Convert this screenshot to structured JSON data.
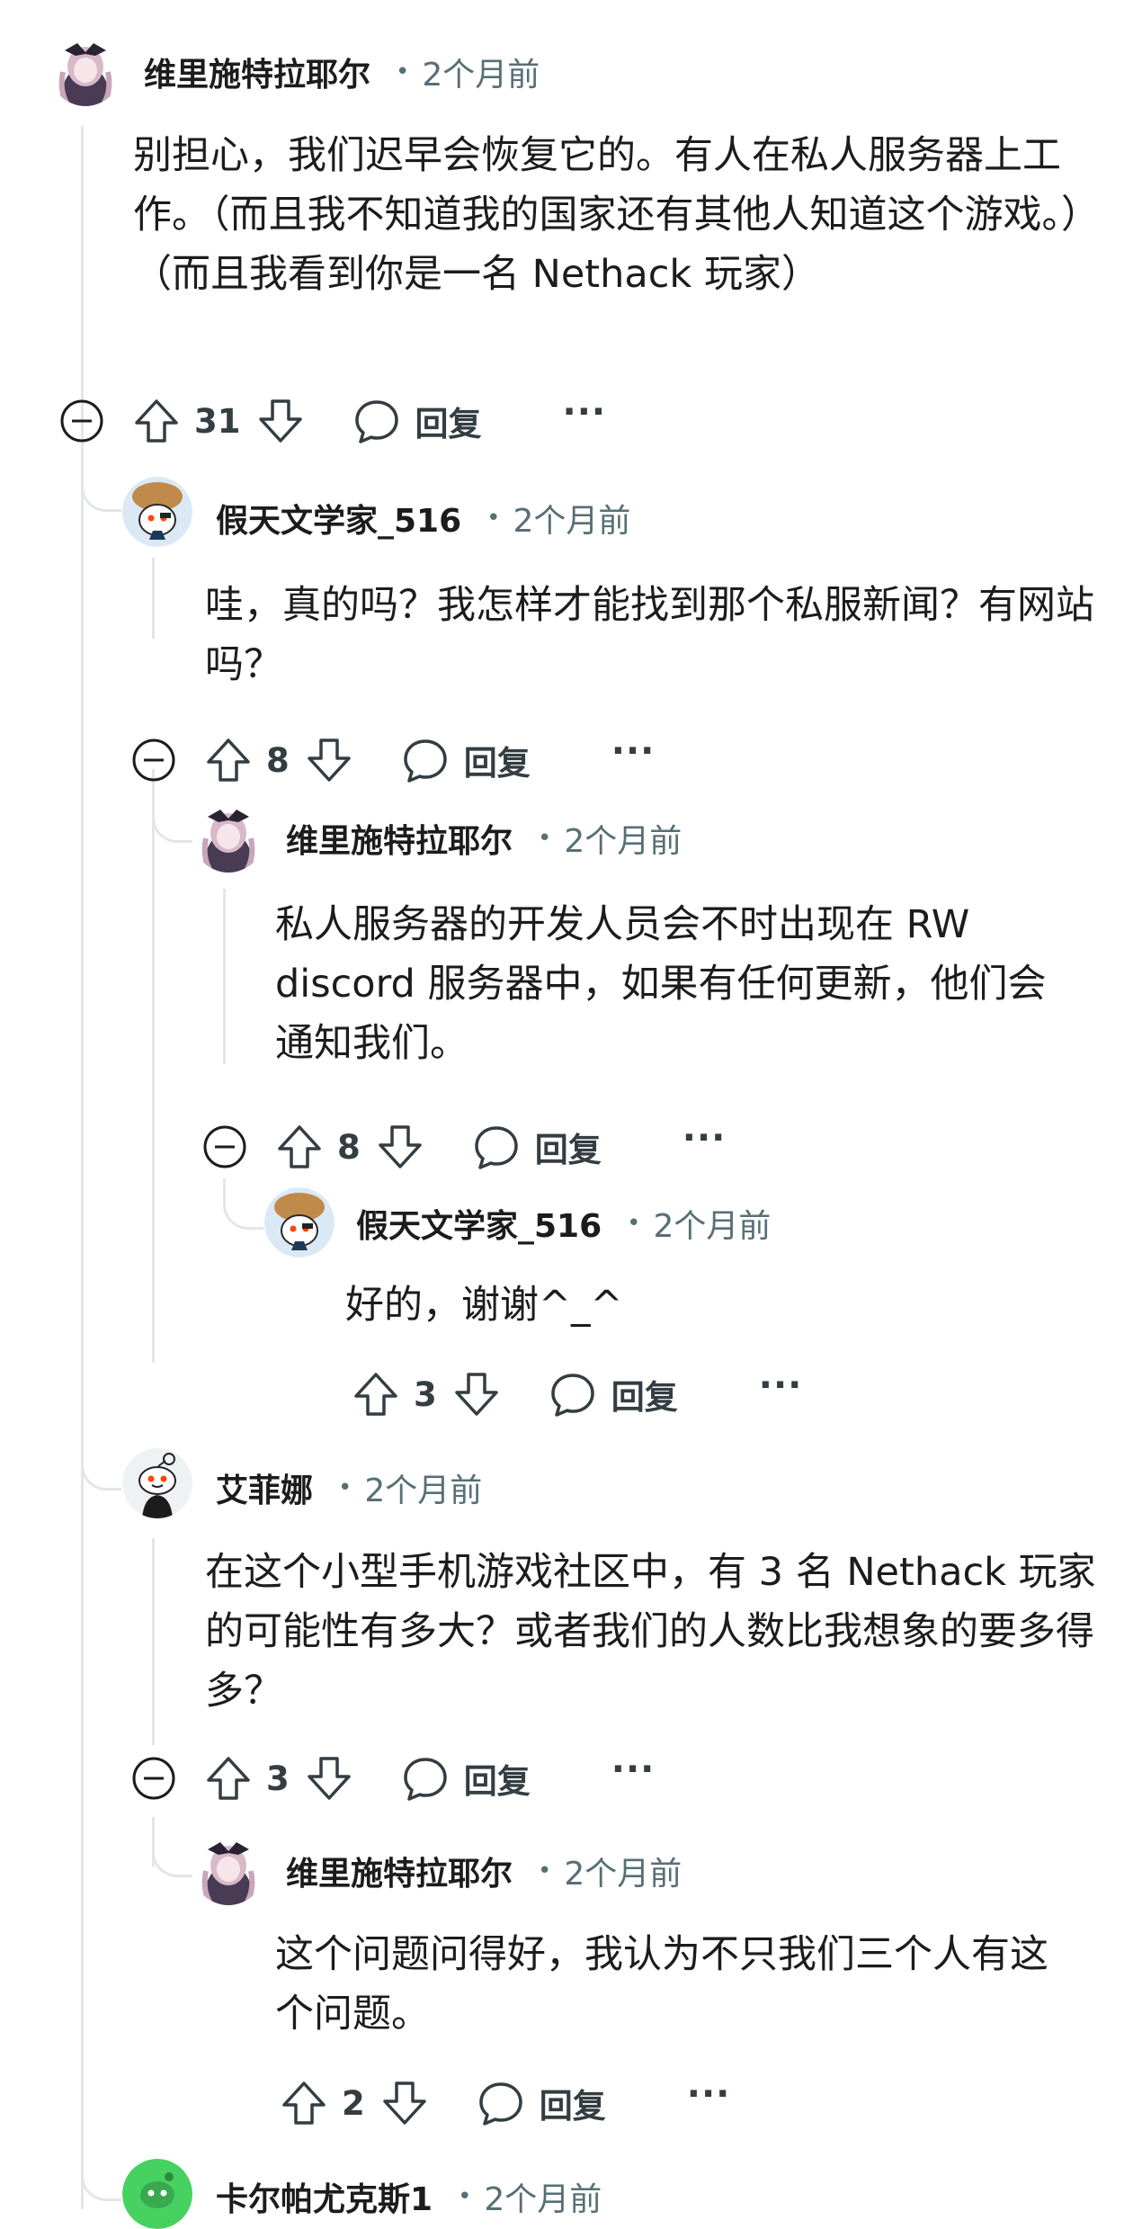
{
  "comments": [
    {
      "author": "维里施特拉耶尔",
      "time": "2个月前",
      "body": "别担心，我们迟早会恢复它的。有人在私人服务器上工作。（而且我不知道我的国家还有其他人知道这个游戏。）（而且我看到你是一名 Nethack 玩家）",
      "votes": "31",
      "reply": "回复",
      "more": "···"
    },
    {
      "author": "假天文学家_516",
      "time": "2个月前",
      "body": "哇，真的吗？我怎样才能找到那个私服新闻？有网站吗？",
      "votes": "8",
      "reply": "回复",
      "more": "···"
    },
    {
      "author": "维里施特拉耶尔",
      "time": "2个月前",
      "body": "私人服务器的开发人员会不时出现在 RW discord 服务器中，如果有任何更新，他们会通知我们。",
      "votes": "8",
      "reply": "回复",
      "more": "···"
    },
    {
      "author": "假天文学家_516",
      "time": "2个月前",
      "body": "好的，谢谢^_^",
      "votes": "3",
      "reply": "回复",
      "more": "···"
    },
    {
      "author": "艾菲娜",
      "time": "2个月前",
      "body": "在这个小型手机游戏社区中，有 3 名 Nethack 玩家的可能性有多大？或者我们的人数比我想象的要多得多？",
      "votes": "3",
      "reply": "回复",
      "more": "···"
    },
    {
      "author": "维里施特拉耶尔",
      "time": "2个月前",
      "body": "这个问题问得好，我认为不只我们三个人有这个问题。",
      "votes": "2",
      "reply": "回复",
      "more": "···"
    },
    {
      "author": "卡尔帕尤克斯1",
      "time": "2个月前"
    }
  ]
}
